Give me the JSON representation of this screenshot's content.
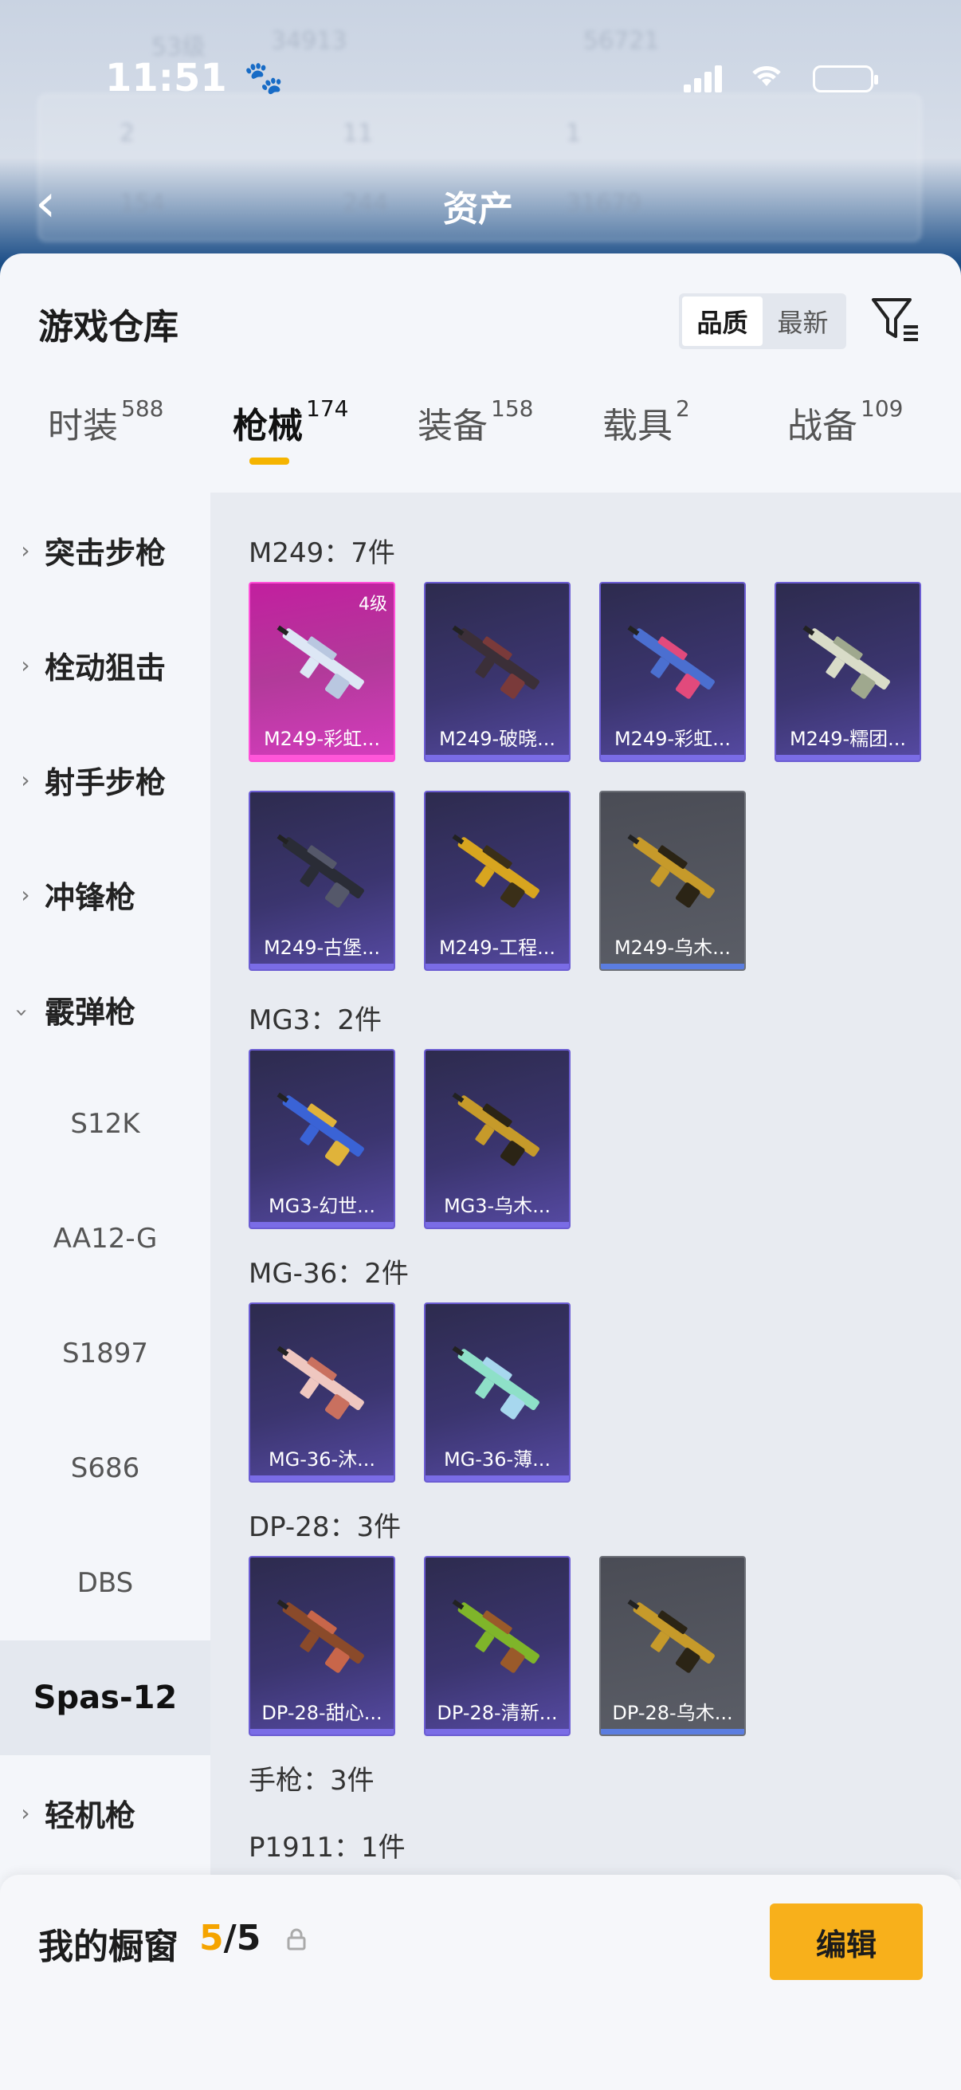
{
  "status_bar": {
    "time": "11:51"
  },
  "header": {
    "title": "资产",
    "bg_stats": [
      "53级",
      "34913",
      "56721",
      "2",
      "11",
      "1",
      "154",
      "244",
      "31679"
    ]
  },
  "sheet": {
    "title": "游戏仓库",
    "sort_options": [
      "品质",
      "最新"
    ],
    "active_sort": "品质",
    "tabs": [
      {
        "label": "时装",
        "count": "588"
      },
      {
        "label": "枪械",
        "count": "174"
      },
      {
        "label": "装备",
        "count": "158"
      },
      {
        "label": "载具",
        "count": "2"
      },
      {
        "label": "战备",
        "count": "109"
      }
    ],
    "active_tab": "枪械"
  },
  "categories": {
    "items": [
      "突击步枪",
      "栓动狙击",
      "射手步枪",
      "冲锋枪",
      "霰弹枪"
    ],
    "shotgun_sub": [
      "S12K",
      "AA12-G",
      "S1897",
      "S686",
      "DBS",
      "Spas-12"
    ],
    "selected_sub": "Spas-12",
    "last": "轻机枪"
  },
  "groups": [
    {
      "title": "M249：7件",
      "items": [
        {
          "name": "M249-彩虹...",
          "level": "4级",
          "rarity": "legend",
          "colors": [
            "#dde7f5",
            "#b9c7e0"
          ]
        },
        {
          "name": "M249-破晓...",
          "rarity": "epic",
          "colors": [
            "#3b2f38",
            "#7a3a3a"
          ]
        },
        {
          "name": "M249-彩虹...",
          "rarity": "epic",
          "colors": [
            "#4b6fd0",
            "#e24a7c"
          ]
        },
        {
          "name": "M249-糯团...",
          "rarity": "epic",
          "colors": [
            "#d9dcc8",
            "#9fa88e"
          ]
        },
        {
          "name": "M249-古堡...",
          "rarity": "epic",
          "colors": [
            "#2a2c36",
            "#55586a"
          ]
        },
        {
          "name": "M249-工程...",
          "rarity": "epic",
          "colors": [
            "#d8a51f",
            "#3a2f18"
          ]
        },
        {
          "name": "M249-乌木...",
          "rarity": "gray",
          "colors": [
            "#c69a2a",
            "#2b2415"
          ]
        }
      ]
    },
    {
      "title": "MG3：2件",
      "items": [
        {
          "name": "MG3-幻世...",
          "rarity": "epic",
          "colors": [
            "#3a63d6",
            "#e0b33a"
          ]
        },
        {
          "name": "MG3-乌木...",
          "rarity": "epic",
          "colors": [
            "#c69a2a",
            "#2b2415"
          ]
        }
      ]
    },
    {
      "title": "MG-36：2件",
      "items": [
        {
          "name": "MG-36-沐...",
          "rarity": "epic",
          "colors": [
            "#efc7c0",
            "#c9705f"
          ]
        },
        {
          "name": "MG-36-薄...",
          "rarity": "epic",
          "colors": [
            "#8ee0c8",
            "#a7d7ee"
          ]
        }
      ]
    },
    {
      "title": "DP-28：3件",
      "items": [
        {
          "name": "DP-28-甜心...",
          "rarity": "epic",
          "colors": [
            "#8a4a2a",
            "#c8664a"
          ]
        },
        {
          "name": "DP-28-清新...",
          "rarity": "epic",
          "colors": [
            "#7fb52a",
            "#9a5a2a"
          ]
        },
        {
          "name": "DP-28-乌木...",
          "rarity": "gray",
          "colors": [
            "#c69a2a",
            "#2b2415"
          ]
        }
      ]
    }
  ],
  "pistol_title": "手枪：3件",
  "p1911_title": "P1911：1件",
  "bottom_bar": {
    "label": "我的橱窗",
    "current": "5",
    "total": "/5",
    "edit_label": "编辑"
  },
  "colors": {
    "accent": "#f5b400",
    "legend": "#c21f9f",
    "epic": "#3b356f"
  }
}
